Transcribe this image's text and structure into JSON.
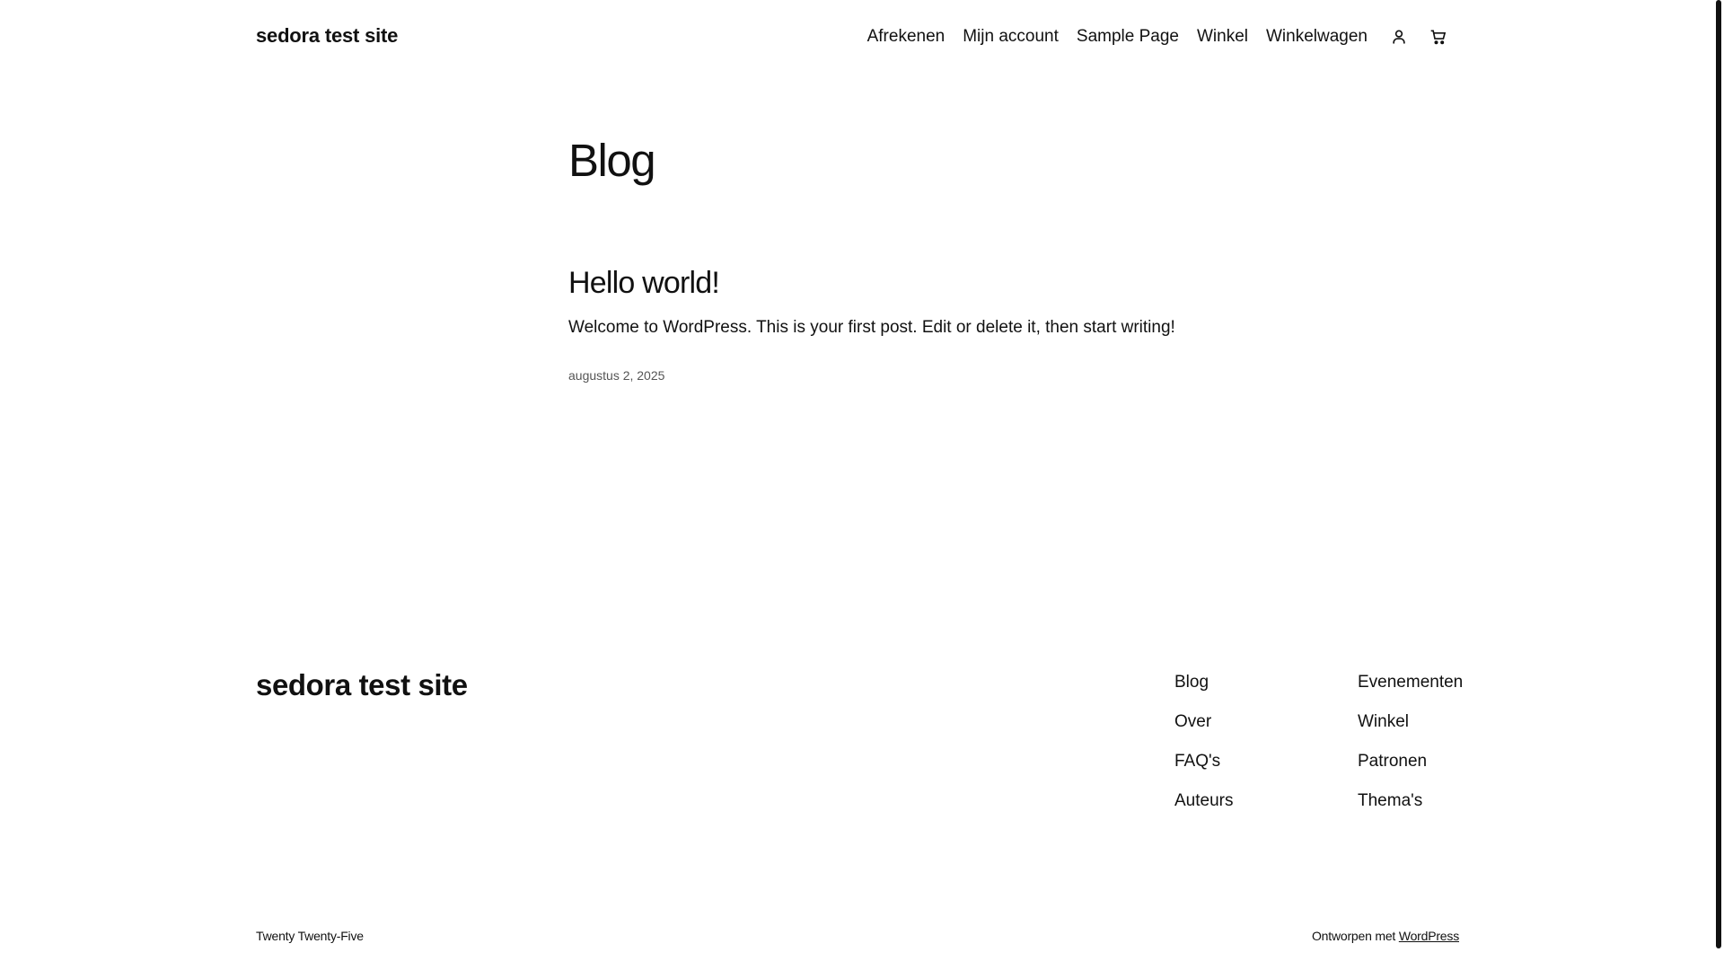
{
  "header": {
    "site_title": "sedora test site",
    "nav": [
      {
        "label": "Afrekenen"
      },
      {
        "label": "Mijn account"
      },
      {
        "label": "Sample Page"
      },
      {
        "label": "Winkel"
      },
      {
        "label": "Winkelwagen"
      }
    ],
    "icons": [
      "account-icon",
      "cart-icon"
    ]
  },
  "main": {
    "page_title": "Blog",
    "posts": [
      {
        "title": "Hello world!",
        "excerpt": "Welcome to WordPress. This is your first post. Edit or delete it, then start writing!",
        "date": "augustus 2, 2025"
      }
    ]
  },
  "footer": {
    "site_title": "sedora test site",
    "col1": [
      {
        "label": "Blog"
      },
      {
        "label": "Over"
      },
      {
        "label": "FAQ's"
      },
      {
        "label": "Auteurs"
      }
    ],
    "col2": [
      {
        "label": "Evenementen"
      },
      {
        "label": "Winkel"
      },
      {
        "label": "Patronen"
      },
      {
        "label": "Thema's"
      }
    ],
    "theme_name": "Twenty Twenty-Five",
    "credit_prefix": "Ontworpen met",
    "credit_link": "WordPress"
  },
  "colors": {
    "text": "#111111",
    "background": "#ffffff",
    "muted": "#555555"
  }
}
